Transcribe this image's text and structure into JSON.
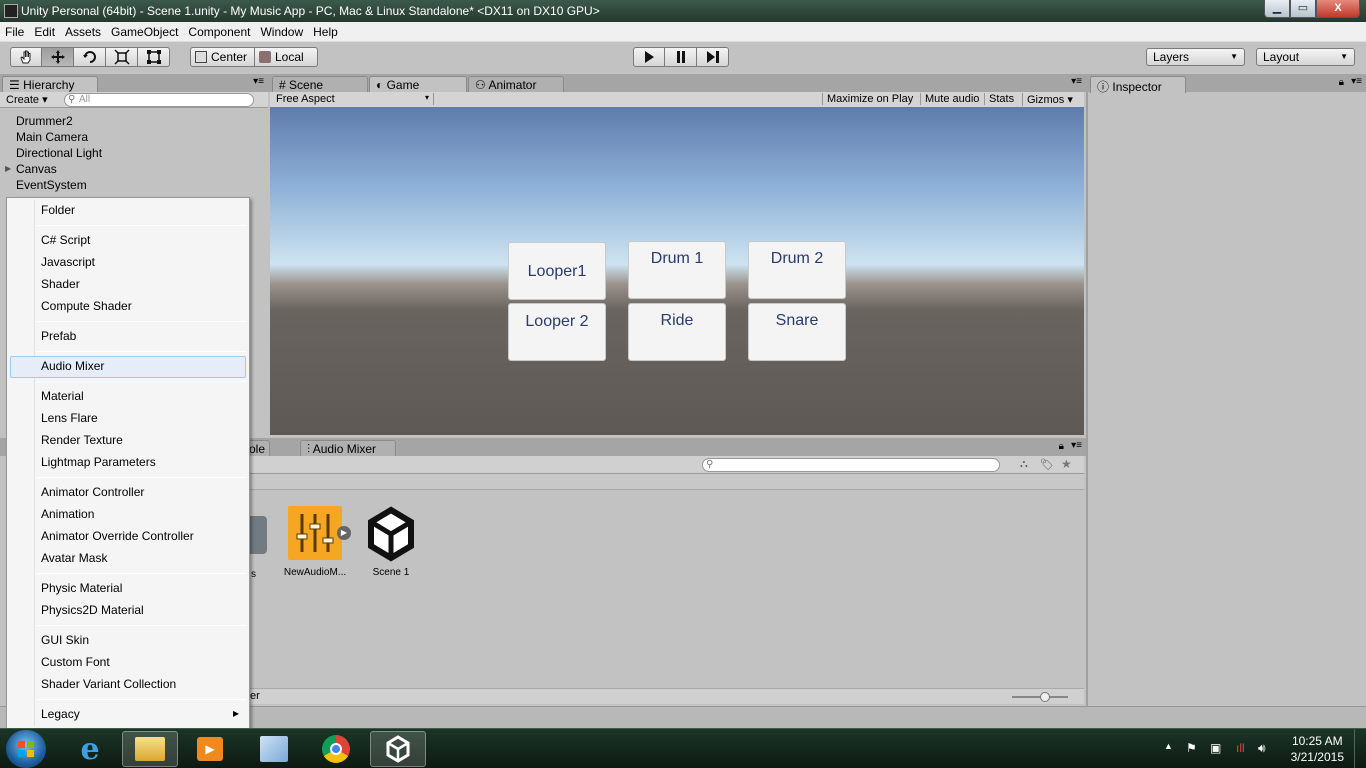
{
  "window": {
    "title": "Unity Personal (64bit) - Scene 1.unity - My Music App - PC, Mac & Linux Standalone* <DX11 on DX10 GPU>",
    "min": "▁",
    "max": "▭",
    "close": "X"
  },
  "menu": [
    "File",
    "Edit",
    "Assets",
    "GameObject",
    "Component",
    "Window",
    "Help"
  ],
  "toolbar": {
    "pivot": "Center",
    "space": "Local",
    "layers": "Layers",
    "layout": "Layout"
  },
  "hierarchy": {
    "tab": "Hierarchy",
    "create": "Create",
    "search_placeholder": "All",
    "items": [
      "Drummer2",
      "Main Camera",
      "Directional Light",
      "Canvas",
      "EventSystem"
    ]
  },
  "center_tabs": {
    "scene": "Scene",
    "game": "Game",
    "animator": "Animator"
  },
  "game_bar": {
    "aspect": "Free Aspect",
    "maximize": "Maximize on Play",
    "mute": "Mute audio",
    "stats": "Stats",
    "gizmos": "Gizmos"
  },
  "game_buttons": [
    "Looper1",
    "Drum 1",
    "Drum 2",
    "Looper 2",
    "Ride",
    "Snare"
  ],
  "inspector": {
    "tab": "Inspector"
  },
  "bottom_tabs": {
    "console_partial": "ole",
    "audio_mixer": "Audio Mixer"
  },
  "project": {
    "assets": [
      {
        "label": "NewAudioM...",
        "icon": "audio-mixer-icon"
      },
      {
        "label": "Scene 1",
        "icon": "unity-scene-icon"
      }
    ],
    "partial_label": "s",
    "footer_partial": "er"
  },
  "context_menu": {
    "items": [
      "Folder",
      "C# Script",
      "Javascript",
      "Shader",
      "Compute Shader",
      "Prefab",
      "Audio Mixer",
      "Material",
      "Lens Flare",
      "Render Texture",
      "Lightmap Parameters",
      "Animator Controller",
      "Animation",
      "Animator Override Controller",
      "Avatar Mask",
      "Physic Material",
      "Physics2D Material",
      "GUI Skin",
      "Custom Font",
      "Shader Variant Collection",
      "Legacy"
    ],
    "highlighted": "Audio Mixer",
    "submenu_arrow": "▸"
  },
  "taskbar": {
    "time": "10:25 AM",
    "date": "3/21/2015",
    "apps": [
      "start-orb",
      "internet-explorer-icon",
      "file-explorer-icon",
      "media-player-icon",
      "paint-icon",
      "chrome-icon",
      "unity-icon"
    ]
  },
  "colors": {
    "unity_panel": "#c2c2c2",
    "game_button_text": "#2a3b6c",
    "menu_highlight": "#e5eef8",
    "mixer_icon": "#f5a623"
  }
}
